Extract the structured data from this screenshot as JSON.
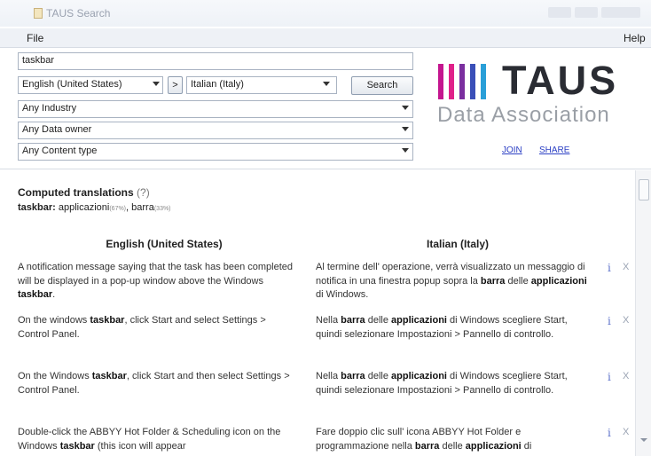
{
  "window": {
    "title": "TAUS Search"
  },
  "menu": {
    "file": "File",
    "help": "Help"
  },
  "search": {
    "query": "taskbar",
    "source_language": "English (United States)",
    "swap_label": ">",
    "target_language": "Italian (Italy)",
    "button_label": "Search",
    "industry": "Any Industry",
    "data_owner": "Any Data owner",
    "content_type": "Any Content type"
  },
  "logo": {
    "wordmark": "TAUS",
    "tagline": "Data Association",
    "join_label": "JOIN",
    "share_label": "SHARE",
    "bar_colors": [
      "#c4168f",
      "#e0218a",
      "#7b2f9f",
      "#3a4fb8",
      "#2a9fd8"
    ]
  },
  "computed": {
    "title": "Computed translations",
    "help_mark": "(?)",
    "term": "taskbar:",
    "translation_1": "applicazioni",
    "translation_1_pct": "(67%)",
    "separator": ",",
    "translation_2": "barra",
    "translation_2_pct": "(33%)"
  },
  "columns": {
    "source": "English (United States)",
    "target": "Italian (Italy)"
  },
  "rows": [
    {
      "source": [
        {
          "t": "A notification message saying that the task has been completed will be displayed in a pop-up window above the Windows "
        },
        {
          "t": "taskbar",
          "b": true
        },
        {
          "t": "."
        }
      ],
      "target": [
        {
          "t": "Al termine dell' operazione, verrà visualizzato un messaggio di notifica in una finestra popup sopra la "
        },
        {
          "t": "barra",
          "b": true
        },
        {
          "t": " delle "
        },
        {
          "t": "applicazioni",
          "b": true
        },
        {
          "t": " di Windows."
        }
      ]
    },
    {
      "source": [
        {
          "t": "On the windows "
        },
        {
          "t": "taskbar",
          "b": true
        },
        {
          "t": ", click Start and select Settings > Control Panel."
        }
      ],
      "target": [
        {
          "t": "Nella "
        },
        {
          "t": "barra",
          "b": true
        },
        {
          "t": " delle "
        },
        {
          "t": "applicazioni",
          "b": true
        },
        {
          "t": " di Windows scegliere Start, quindi selezionare Impostazioni > Pannello di controllo."
        }
      ]
    },
    {
      "source": [
        {
          "t": "On the Windows "
        },
        {
          "t": "taskbar",
          "b": true
        },
        {
          "t": ", click Start and then select Settings > Control Panel."
        }
      ],
      "target": [
        {
          "t": "Nella "
        },
        {
          "t": "barra",
          "b": true
        },
        {
          "t": " delle "
        },
        {
          "t": "applicazioni",
          "b": true
        },
        {
          "t": " di Windows scegliere Start, quindi selezionare Impostazioni > Pannello di controllo."
        }
      ]
    },
    {
      "source": [
        {
          "t": "Double-click the ABBYY Hot Folder & Scheduling icon on the Windows "
        },
        {
          "t": "taskbar",
          "b": true
        },
        {
          "t": " (this icon will appear"
        }
      ],
      "target": [
        {
          "t": "Fare doppio clic sull' icona ABBYY Hot Folder e programmazione nella "
        },
        {
          "t": "barra",
          "b": true
        },
        {
          "t": " delle "
        },
        {
          "t": "applicazioni",
          "b": true
        },
        {
          "t": " di"
        }
      ]
    }
  ],
  "row_icons": {
    "info": "i",
    "remove": "X"
  },
  "colors": {
    "link": "#2b3fc4",
    "border": "#a9b3c2"
  }
}
